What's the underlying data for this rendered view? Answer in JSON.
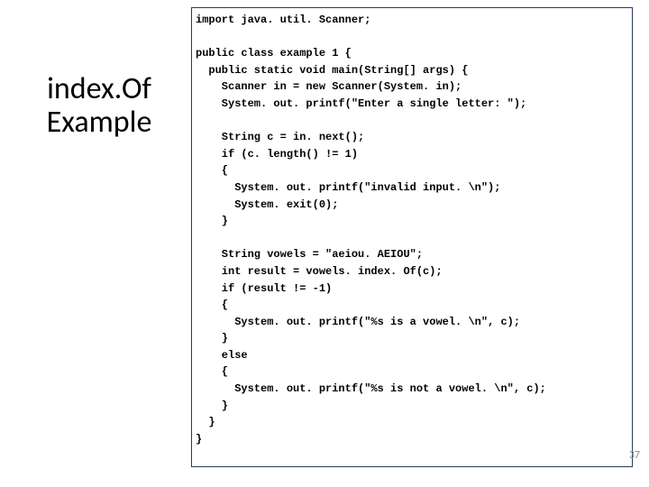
{
  "title": {
    "line1": "index.Of",
    "line2": "Example"
  },
  "code": "import java. util. Scanner;\n\npublic class example 1 {\n  public static void main(String[] args) {\n    Scanner in = new Scanner(System. in);\n    System. out. printf(\"Enter a single letter: \");\n\n    String c = in. next();\n    if (c. length() != 1)\n    {\n      System. out. printf(\"invalid input. \\n\");\n      System. exit(0);\n    }\n\n    String vowels = \"aeiou. AEIOU\";\n    int result = vowels. index. Of(c);\n    if (result != -1)\n    {\n      System. out. printf(\"%s is a vowel. \\n\", c);\n    }\n    else\n    {\n      System. out. printf(\"%s is not a vowel. \\n\", c);\n    }\n  }\n}",
  "slide_number": "37"
}
